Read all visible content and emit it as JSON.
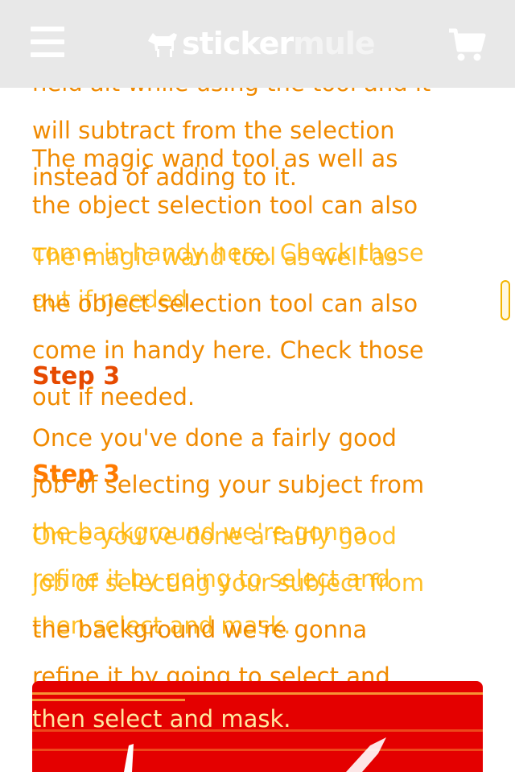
{
  "header": {
    "brand_part1": "sticker",
    "brand_part2": "mule"
  },
  "icons": {
    "menu": "hamburger-menu-icon",
    "cart": "shopping-cart-icon",
    "logo": "mule-logo-icon"
  },
  "colors": {
    "header_bg": "#e8e8e8",
    "text": "#f08a00",
    "step_title": "#e64a00",
    "image_bg": "#e40000"
  },
  "article": {
    "partial_top": "held alt while using the tool and it",
    "alt_tip_line1": "will subtract from the selection",
    "alt_tip_line2": "instead of adding to it.",
    "wand_line1": "The magic wand tool as well as",
    "wand_line2": "the object selection tool can also",
    "wand_line3": "come in handy here. Check those",
    "wand_line4": "out if needed.",
    "step3_title": "Step 3",
    "step3_line1": "Once you've done a fairly good",
    "step3_line2": "job of selecting your subject from",
    "step3_line3": "the background we're gonna",
    "step3_line4": "refine it by going to select and",
    "step3_line5": "then select and mask."
  }
}
